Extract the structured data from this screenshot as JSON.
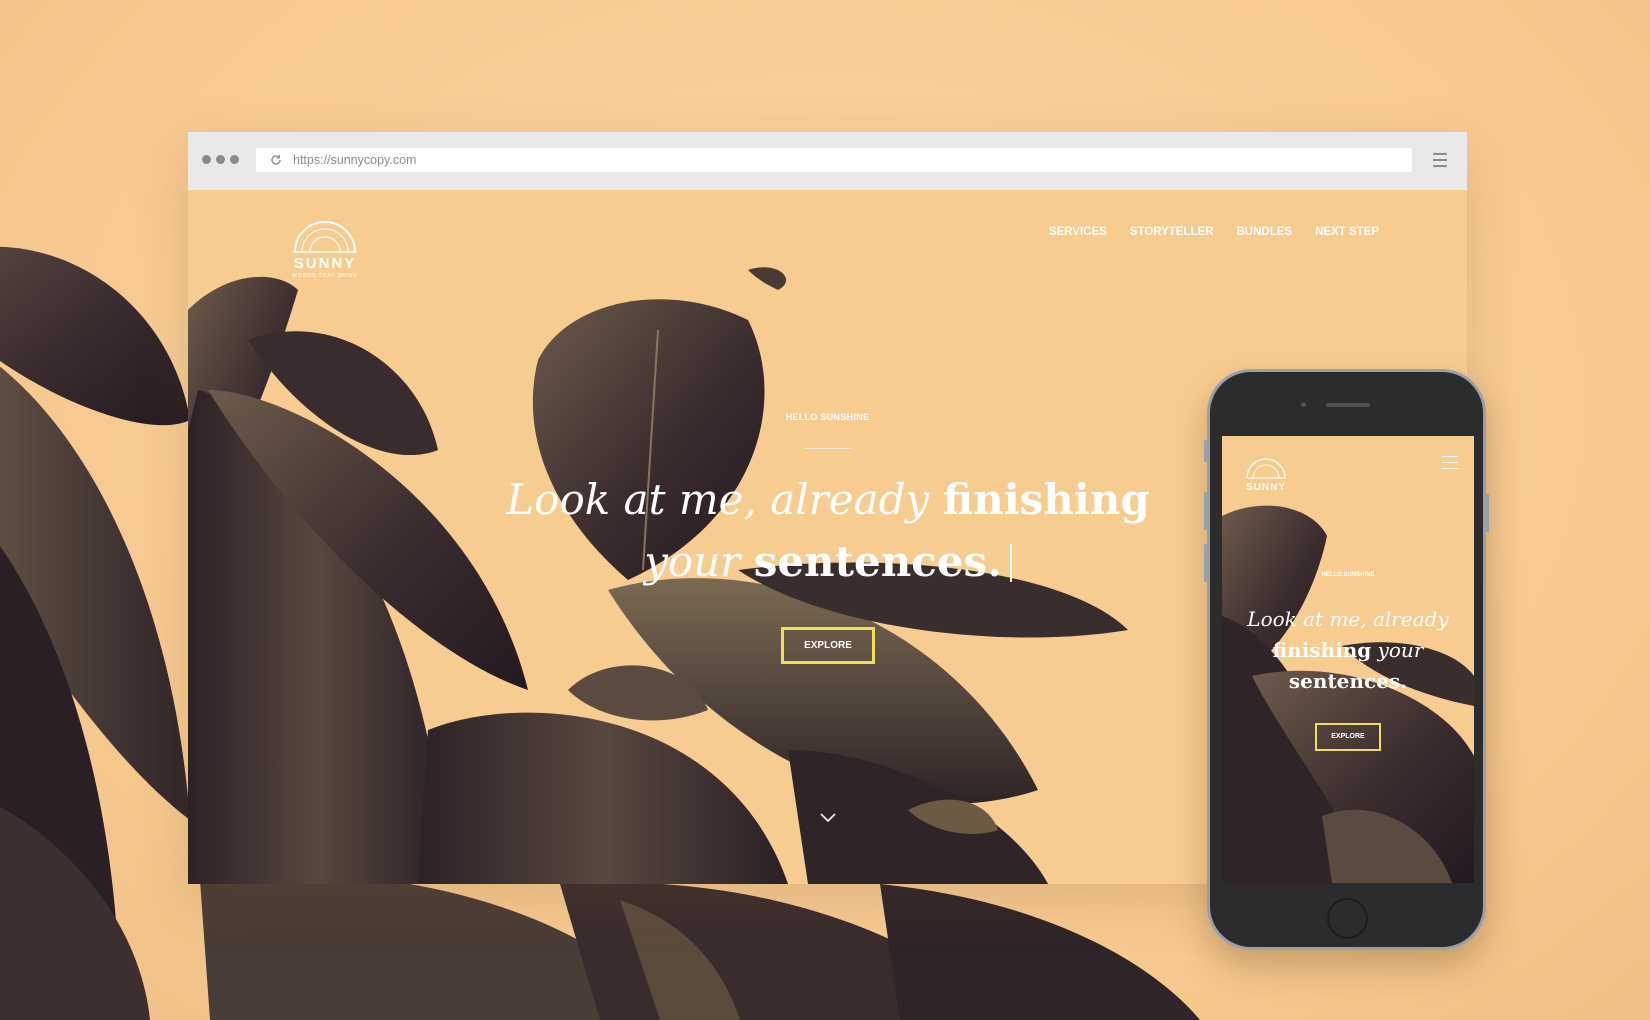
{
  "colors": {
    "background": "#f8cf97",
    "leaf_dark": "#3b2c2c",
    "accent_button_border": "#f2de5e",
    "text_light": "#ffffff",
    "browser_chrome": "#e9e9e9"
  },
  "browser": {
    "url": "https://sunnycopy.com",
    "icons": [
      "window-dots-icon",
      "reload-icon",
      "hamburger-menu-icon"
    ]
  },
  "site": {
    "logo": {
      "name": "SUNNY",
      "tagline": "WORDS THAT SHINE",
      "icon": "sun-arch-icon"
    },
    "nav": [
      "SERVICES",
      "STORYTELLER",
      "BUNDLES",
      "NEXT STEP"
    ],
    "hero": {
      "eyebrow": "HELLO SUNSHINE",
      "headline_line1_italic": "Look at me, already",
      "headline_line1_bold": "finishing",
      "headline_line2_italic": "your",
      "headline_line2_bold": "sentences.",
      "cta_label": "EXPLORE",
      "scroll_icon": "chevron-down-icon"
    }
  },
  "mobile": {
    "logo_name": "SUNNY",
    "menu_icon": "hamburger-menu-icon",
    "eyebrow": "HELLO SUNSHINE",
    "headline_line1_italic": "Look at me, already",
    "headline_line2_bold": "finishing",
    "headline_line2_italic": "your",
    "headline_line3_bold": "sentences.",
    "cta_label": "EXPLORE"
  }
}
